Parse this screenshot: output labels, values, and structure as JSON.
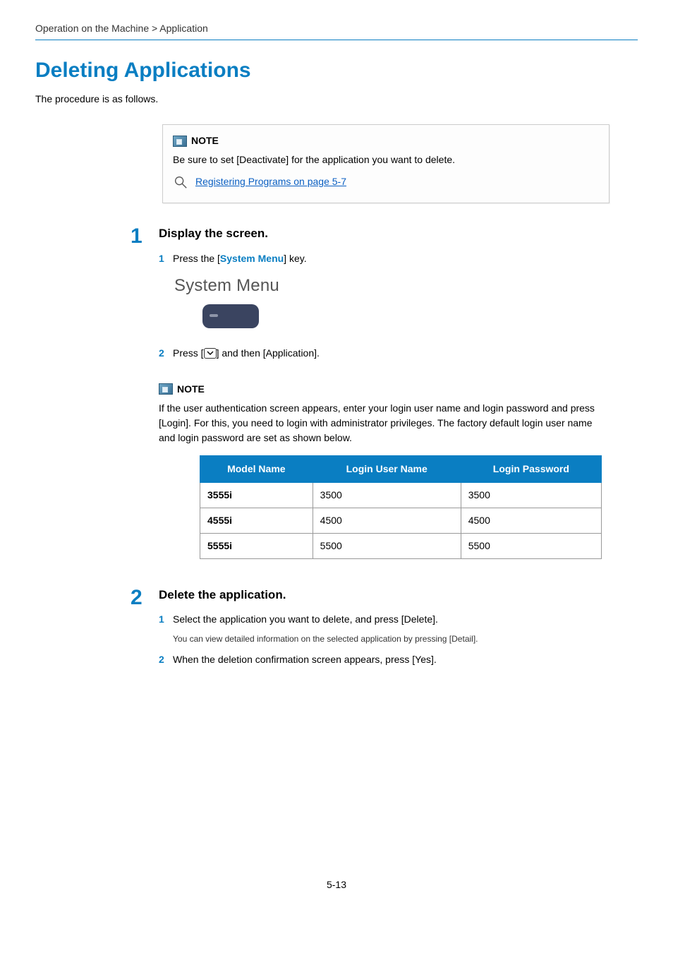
{
  "breadcrumb": "Operation on the Machine > Application",
  "title": "Deleting Applications",
  "intro": "The procedure is as follows.",
  "note_top": {
    "heading": "NOTE",
    "text": "Be sure to set [Deactivate] for the application you want to delete.",
    "link": "Registering Programs on page 5-7"
  },
  "step1": {
    "num": "1",
    "title": "Display the screen.",
    "sub1_num": "1",
    "sub1_pre": "Press the [",
    "sub1_emph": "System Menu",
    "sub1_post": "] key.",
    "sys_label": "System Menu",
    "sub2_num": "2",
    "sub2_pre": "Press [",
    "sub2_post": "] and then [Application].",
    "note_heading": "NOTE",
    "note_text": "If the user authentication screen appears, enter your login user name and login password and press [Login]. For this, you need to login with administrator privileges. The factory default login user name and login password are set as shown below.",
    "table": {
      "h1": "Model Name",
      "h2": "Login User Name",
      "h3": "Login Password",
      "rows": [
        {
          "c1": "3555i",
          "c2": "3500",
          "c3": "3500"
        },
        {
          "c1": "4555i",
          "c2": "4500",
          "c3": "4500"
        },
        {
          "c1": "5555i",
          "c2": "5500",
          "c3": "5500"
        }
      ]
    }
  },
  "step2": {
    "num": "2",
    "title": "Delete the application.",
    "sub1_num": "1",
    "sub1_text": "Select the application you want to delete, and press [Delete].",
    "sub1_hint": "You can view detailed information on the selected application by pressing [Detail].",
    "sub2_num": "2",
    "sub2_text": "When the deletion confirmation screen appears, press [Yes]."
  },
  "page_num": "5-13"
}
